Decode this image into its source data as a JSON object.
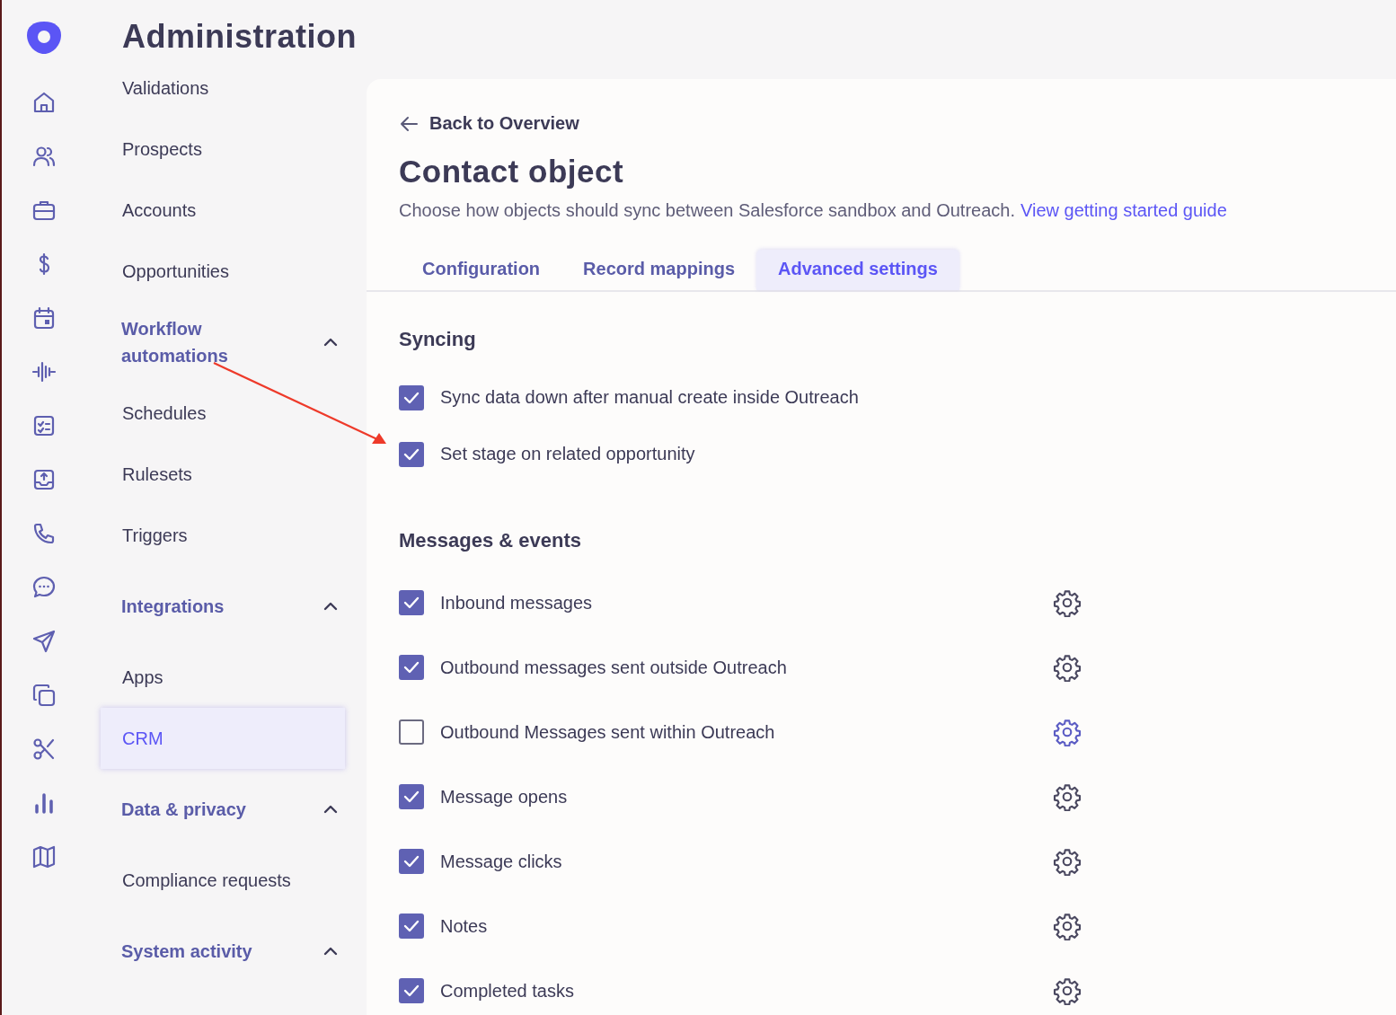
{
  "header": {
    "title": "Administration"
  },
  "sidebar": {
    "items": [
      {
        "label": "Validations",
        "selected": false
      },
      {
        "label": "Prospects",
        "selected": false
      },
      {
        "label": "Accounts",
        "selected": false
      },
      {
        "label": "Opportunities",
        "selected": false
      }
    ],
    "groups": [
      {
        "label": "Workflow automations",
        "expanded": true,
        "children": [
          {
            "label": "Schedules",
            "selected": false
          },
          {
            "label": "Rulesets",
            "selected": false
          },
          {
            "label": "Triggers",
            "selected": false
          }
        ]
      },
      {
        "label": "Integrations",
        "expanded": true,
        "children": [
          {
            "label": "Apps",
            "selected": false
          },
          {
            "label": "CRM",
            "selected": true
          }
        ]
      },
      {
        "label": "Data & privacy",
        "expanded": true,
        "children": [
          {
            "label": "Compliance requests",
            "selected": false
          }
        ]
      },
      {
        "label": "System activity",
        "expanded": true
      }
    ]
  },
  "main": {
    "back_link": "Back to Overview",
    "title": "Contact object",
    "description": "Choose how objects should sync between Salesforce sandbox and Outreach.",
    "guide_link": "View getting started guide",
    "tabs": [
      {
        "label": "Configuration",
        "selected": false
      },
      {
        "label": "Record mappings",
        "selected": false
      },
      {
        "label": "Advanced settings",
        "selected": true
      }
    ],
    "sections": [
      {
        "heading": "Syncing",
        "items": [
          {
            "kind": "plain",
            "label": "Sync data down after manual create inside Outreach",
            "checked": true
          },
          {
            "kind": "plain",
            "label": "Set stage on related opportunity",
            "checked": true
          }
        ]
      },
      {
        "heading": "Messages & events",
        "items": [
          {
            "kind": "settings",
            "label": "Inbound messages",
            "checked": true,
            "settings_highlighted": false
          },
          {
            "kind": "settings",
            "label": "Outbound messages sent outside Outreach",
            "checked": true,
            "settings_highlighted": false
          },
          {
            "kind": "settings",
            "label": "Outbound Messages sent within Outreach",
            "checked": false,
            "settings_highlighted": true
          },
          {
            "kind": "settings",
            "label": "Message opens",
            "checked": true,
            "settings_highlighted": false
          },
          {
            "kind": "settings",
            "label": "Message clicks",
            "checked": true,
            "settings_highlighted": false
          },
          {
            "kind": "settings",
            "label": "Notes",
            "checked": true,
            "settings_highlighted": false
          },
          {
            "kind": "settings",
            "label": "Completed tasks",
            "checked": true,
            "settings_highlighted": false
          }
        ]
      }
    ]
  }
}
